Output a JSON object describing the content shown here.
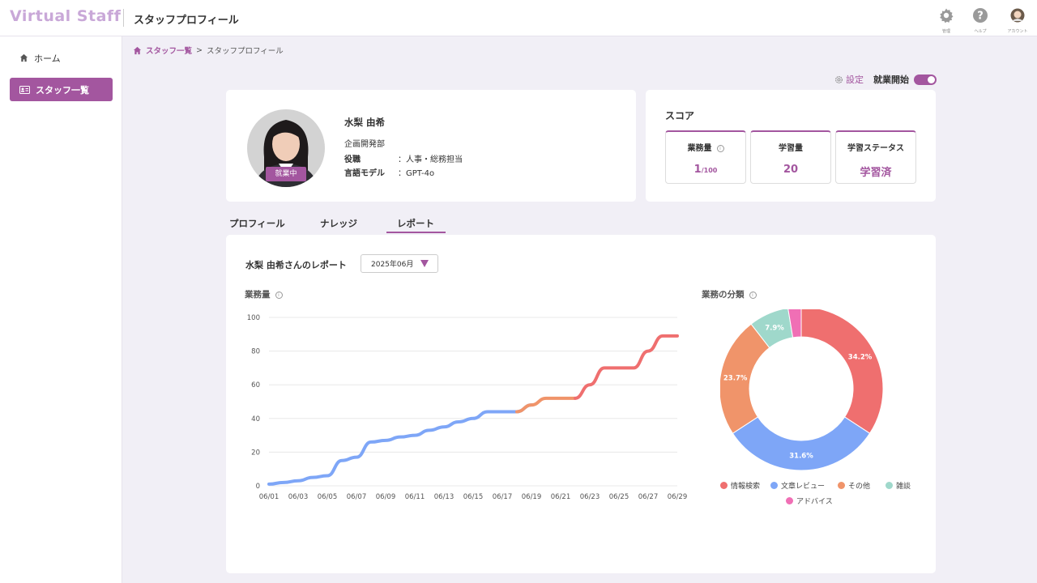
{
  "app": {
    "logo": "Virtual Staff",
    "page_title": "スタッフプロフィール"
  },
  "top_icons": [
    {
      "name": "settings",
      "label": "管理"
    },
    {
      "name": "help",
      "label": "ヘルプ"
    },
    {
      "name": "account",
      "label": "アカウント"
    }
  ],
  "sidebar": {
    "items": [
      {
        "label": "ホーム"
      },
      {
        "label": "スタッフ一覧"
      }
    ]
  },
  "breadcrumb": {
    "link": "スタッフ一覧",
    "separator": ">",
    "current": "スタッフプロフィール"
  },
  "actions": {
    "settings_label": "設定",
    "toggle_label": "就業開始",
    "toggle_on": true
  },
  "profile": {
    "name": "水梨 由希",
    "department": "企画開発部",
    "role_label": "役職",
    "role_value": "：人事・総務担当",
    "model_label": "言語モデル",
    "model_value": "：GPT-4o",
    "status_badge": "就業中"
  },
  "score": {
    "title": "スコア",
    "items": [
      {
        "label": "業務量",
        "value": "1",
        "suffix": "/100",
        "info": true
      },
      {
        "label": "学習量",
        "value": "20",
        "suffix": "",
        "info": false
      },
      {
        "label": "学習ステータス",
        "value": "学習済",
        "suffix": "",
        "info": false
      }
    ]
  },
  "tabs": [
    {
      "label": "プロフィール"
    },
    {
      "label": "ナレッジ"
    },
    {
      "label": "レポート",
      "active": true
    }
  ],
  "report": {
    "title": "水梨 由希さんのレポート",
    "month": "2025年06月",
    "line_title": "業務量",
    "pie_title": "業務の分類"
  },
  "colors": {
    "accent": "#a3569f",
    "blue": "#7ea6f7",
    "orange": "#f0946a",
    "red": "#ef6f6f",
    "teal": "#9fd8cb",
    "pink": "#f06fb5"
  },
  "chart_data": [
    {
      "type": "line",
      "x": [
        "06/01",
        "06/02",
        "06/03",
        "06/04",
        "06/05",
        "06/06",
        "06/07",
        "06/08",
        "06/09",
        "06/10",
        "06/11",
        "06/12",
        "06/13",
        "06/14",
        "06/15",
        "06/16",
        "06/17",
        "06/18",
        "06/19",
        "06/20",
        "06/21",
        "06/22",
        "06/23",
        "06/24",
        "06/25",
        "06/26",
        "06/27",
        "06/28",
        "06/29"
      ],
      "x_ticks": [
        "06/01",
        "06/03",
        "06/05",
        "06/07",
        "06/09",
        "06/11",
        "06/13",
        "06/15",
        "06/17",
        "06/19",
        "06/21",
        "06/23",
        "06/25",
        "06/27",
        "06/29"
      ],
      "y": [
        1,
        2,
        3,
        5,
        6,
        15,
        17,
        26,
        27,
        29,
        30,
        33,
        35,
        38,
        40,
        44,
        44,
        44,
        48,
        52,
        52,
        52,
        60,
        70,
        70,
        70,
        80,
        89,
        89
      ],
      "ylim": [
        0,
        100
      ],
      "y_ticks": [
        0,
        20,
        40,
        60,
        80,
        100
      ],
      "grid": true
    },
    {
      "type": "pie",
      "donut": true,
      "labels": [
        "情報検索",
        "文章レビュー",
        "その他",
        "雑談",
        "アドバイス"
      ],
      "values": [
        34.2,
        31.6,
        23.7,
        7.9,
        2.6
      ],
      "value_labels": [
        "34.2%",
        "31.6%",
        "23.7%",
        "7.9%",
        ""
      ],
      "legend_position": "bottom"
    }
  ]
}
